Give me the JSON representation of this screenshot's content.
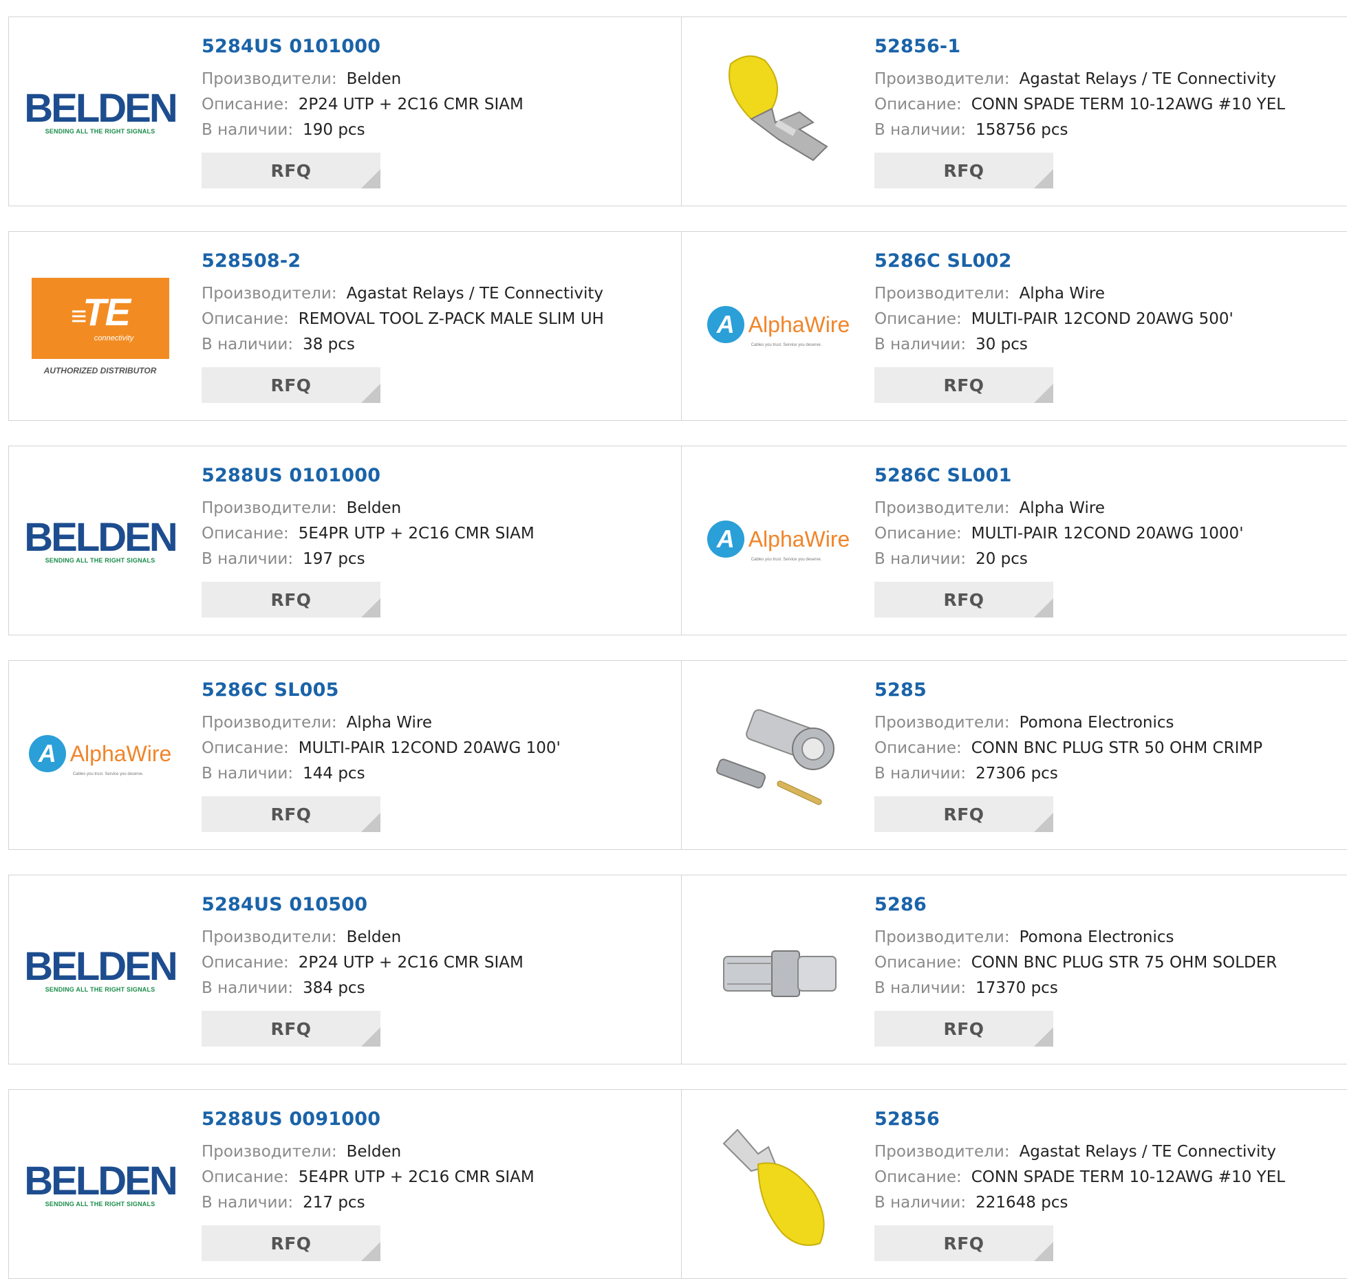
{
  "labels": {
    "manufacturer": "Производители:",
    "description": "Описание:",
    "stock": "В наличии:",
    "rfq": "RFQ"
  },
  "logos": {
    "belden": {
      "name": "BELDEN",
      "tagline": "SENDING ALL THE RIGHT SIGNALS"
    },
    "te": {
      "name": "TE",
      "sub": "connectivity",
      "auth": "AUTHORIZED DISTRIBUTOR"
    },
    "alphawire": {
      "mark": "A",
      "name": "AlphaWire",
      "sub": "Cables you trust. Service you deserve."
    }
  },
  "products": [
    {
      "pn": "5284US 0101000",
      "manufacturer": "Belden",
      "description": "2P24 UTP + 2C16 CMR SIAM",
      "stock": "190 pcs",
      "image": "belden-logo"
    },
    {
      "pn": "52856-1",
      "manufacturer": "Agastat Relays / TE Connectivity",
      "description": "CONN SPADE TERM 10-12AWG #10 YEL",
      "stock": "158756 pcs",
      "image": "spade-terminal-photo"
    },
    {
      "pn": "528508-2",
      "manufacturer": "Agastat Relays / TE Connectivity",
      "description": "REMOVAL TOOL Z-PACK MALE SLIM UH",
      "stock": "38 pcs",
      "image": "te-logo"
    },
    {
      "pn": "5286C SL002",
      "manufacturer": "Alpha Wire",
      "description": "MULTI-PAIR 12COND 20AWG 500'",
      "stock": "30 pcs",
      "image": "alphawire-logo"
    },
    {
      "pn": "5288US 0101000",
      "manufacturer": "Belden",
      "description": "5E4PR UTP + 2C16 CMR SIAM",
      "stock": "197 pcs",
      "image": "belden-logo"
    },
    {
      "pn": "5286C SL001",
      "manufacturer": "Alpha Wire",
      "description": "MULTI-PAIR 12COND 20AWG 1000'",
      "stock": "20 pcs",
      "image": "alphawire-logo"
    },
    {
      "pn": "5286C SL005",
      "manufacturer": "Alpha Wire",
      "description": "MULTI-PAIR 12COND 20AWG 100'",
      "stock": "144 pcs",
      "image": "alphawire-logo"
    },
    {
      "pn": "5285",
      "manufacturer": "Pomona Electronics",
      "description": "CONN BNC PLUG STR 50 OHM CRIMP",
      "stock": "27306 pcs",
      "image": "bnc-crimp-photo"
    },
    {
      "pn": "5284US 010500",
      "manufacturer": "Belden",
      "description": "2P24 UTP + 2C16 CMR SIAM",
      "stock": "384 pcs",
      "image": "belden-logo"
    },
    {
      "pn": "5286",
      "manufacturer": "Pomona Electronics",
      "description": "CONN BNC PLUG STR 75 OHM SOLDER",
      "stock": "17370 pcs",
      "image": "bnc-solder-photo"
    },
    {
      "pn": "5288US 0091000",
      "manufacturer": "Belden",
      "description": "5E4PR UTP + 2C16 CMR SIAM",
      "stock": "217 pcs",
      "image": "belden-logo"
    },
    {
      "pn": "52856",
      "manufacturer": "Agastat Relays / TE Connectivity",
      "description": "CONN SPADE TERM 10-12AWG #10 YEL",
      "stock": "221648 pcs",
      "image": "spade-terminal-photo-2"
    }
  ],
  "colors": {
    "part_number": "#1a63a8",
    "border": "#d4d4d4",
    "rfq_bg": "#ececec"
  }
}
